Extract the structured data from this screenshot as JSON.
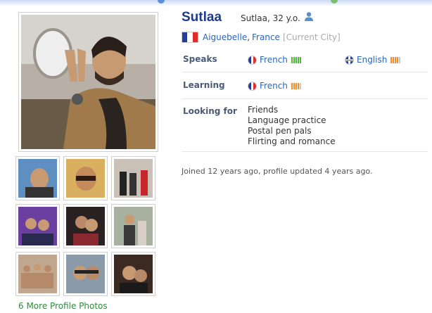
{
  "colors": {
    "name": "#1e3a8a",
    "link": "#2a64b6",
    "label": "#4a5a7a",
    "more_photos": "#2e8b3a",
    "native_bars": "#4cbb3c",
    "learning_bars": "#f08a2a",
    "english_bars": "#f08a2a"
  },
  "profile": {
    "name": "Sutlaa",
    "subline": "Sutlaa, 32 y.o.",
    "city": "Aiguebelle",
    "country": "France",
    "city_tag": "[Current City]"
  },
  "speaks": {
    "label": "Speaks",
    "languages": [
      {
        "name": "French",
        "flag": "france-flag-icon",
        "level": "native"
      },
      {
        "name": "English",
        "flag": "uk-flag-icon",
        "level": "learning"
      }
    ]
  },
  "learning": {
    "label": "Learning",
    "languages": [
      {
        "name": "French",
        "flag": "france-flag-icon",
        "level": "learning"
      }
    ]
  },
  "looking_for": {
    "label": "Looking for",
    "items": [
      "Friends",
      "Language practice",
      "Postal pen pals",
      "Flirting and romance"
    ]
  },
  "joined_text": "Joined 12 years ago, profile updated 4 years ago.",
  "more_photos_text": "6 More Profile Photos"
}
